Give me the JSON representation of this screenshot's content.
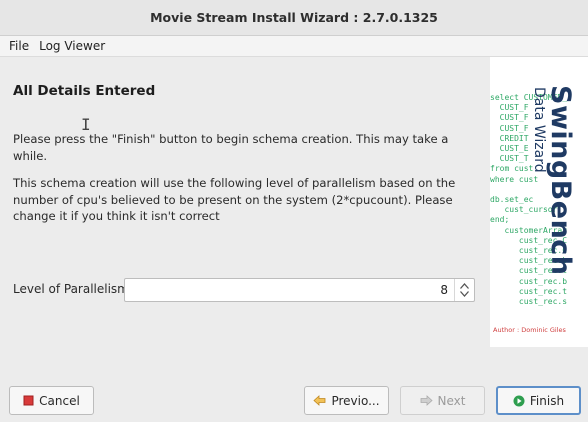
{
  "window": {
    "title": "Movie Stream Install Wizard : 2.7.0.1325"
  },
  "menu": {
    "items": [
      "File",
      "Log Viewer"
    ]
  },
  "page": {
    "heading": "All Details Entered",
    "instruction": "Please press the \"Finish\" button to begin schema creation. This may take a while.",
    "parallelism_note": "This schema creation will use the following level of parallelism based on the number of cpu's believed to be present on the system (2*cpucount). Please change it if you think it isn't correct"
  },
  "parallelism": {
    "label": "Level of Parallelism",
    "value": "8"
  },
  "sidebar": {
    "brand": "SwingBench",
    "subtitle": "Data Wizard",
    "author": "Author : Dominic Giles",
    "code_lines": [
      "select CUSTOMER_",
      "  CUST_F",
      "  CUST_F",
      "  CUST_F",
      "  CREDIT",
      "  CUST_E",
      "  CUST_T",
      "from cust",
      "where cust",
      "",
      "db.set_ec",
      "   cust_cursor",
      "end;",
      "   customerArray",
      "      cust_rec.C",
      "      cust_rec.C",
      "      cust_rec.b",
      "      cust_rec.l",
      "      cust_rec.b",
      "      cust_rec.t",
      "      cust_rec.s"
    ]
  },
  "buttons": {
    "cancel": "Cancel",
    "previous": "Previo...",
    "next": "Next",
    "finish": "Finish"
  },
  "colors": {
    "finish_icon": "#2e9e4f",
    "cancel_icon": "#d83a3a",
    "prev_icon": "#e0a030",
    "code_green": "#2fa866",
    "brand_navy": "#1f3a63"
  }
}
